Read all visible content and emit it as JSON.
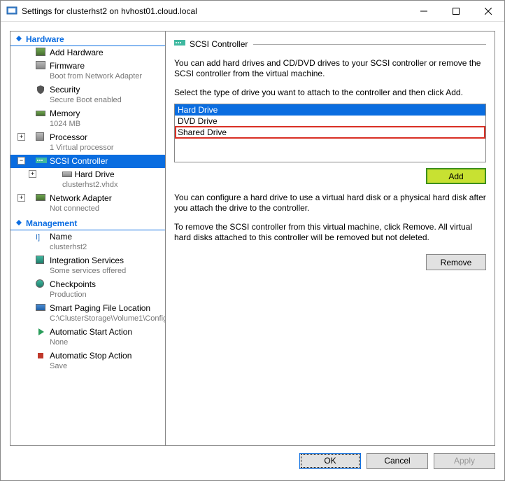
{
  "window": {
    "title": "Settings for clusterhst2 on hvhost01.cloud.local"
  },
  "sections": {
    "hardware": "Hardware",
    "management": "Management"
  },
  "tree": {
    "addHardware": {
      "label": "Add Hardware"
    },
    "firmware": {
      "label": "Firmware",
      "sub": "Boot from Network Adapter"
    },
    "security": {
      "label": "Security",
      "sub": "Secure Boot enabled"
    },
    "memory": {
      "label": "Memory",
      "sub": "1024 MB"
    },
    "processor": {
      "label": "Processor",
      "sub": "1 Virtual processor"
    },
    "scsi": {
      "label": "SCSI Controller"
    },
    "hardDrive": {
      "label": "Hard Drive",
      "sub": "clusterhst2.vhdx"
    },
    "netAdapter": {
      "label": "Network Adapter",
      "sub": "Not connected"
    },
    "name": {
      "label": "Name",
      "sub": "clusterhst2"
    },
    "integration": {
      "label": "Integration Services",
      "sub": "Some services offered"
    },
    "checkpoints": {
      "label": "Checkpoints",
      "sub": "Production"
    },
    "smartPaging": {
      "label": "Smart Paging File Location",
      "sub": "C:\\ClusterStorage\\Volume1\\Config"
    },
    "autoStart": {
      "label": "Automatic Start Action",
      "sub": "None"
    },
    "autoStop": {
      "label": "Automatic Stop Action",
      "sub": "Save"
    }
  },
  "panel": {
    "title": "SCSI Controller",
    "desc1": "You can add hard drives and CD/DVD drives to your SCSI controller or remove the SCSI controller from the virtual machine.",
    "desc2": "Select the type of drive you want to attach to the controller and then click Add.",
    "options": {
      "hardDrive": "Hard Drive",
      "dvdDrive": "DVD Drive",
      "sharedDrive": "Shared Drive"
    },
    "addBtn": "Add",
    "desc3": "You can configure a hard drive to use a virtual hard disk or a physical hard disk after you attach the drive to the controller.",
    "desc4": "To remove the SCSI controller from this virtual machine, click Remove. All virtual hard disks attached to this controller will be removed but not deleted.",
    "removeBtn": "Remove"
  },
  "buttons": {
    "ok": "OK",
    "cancel": "Cancel",
    "apply": "Apply"
  }
}
